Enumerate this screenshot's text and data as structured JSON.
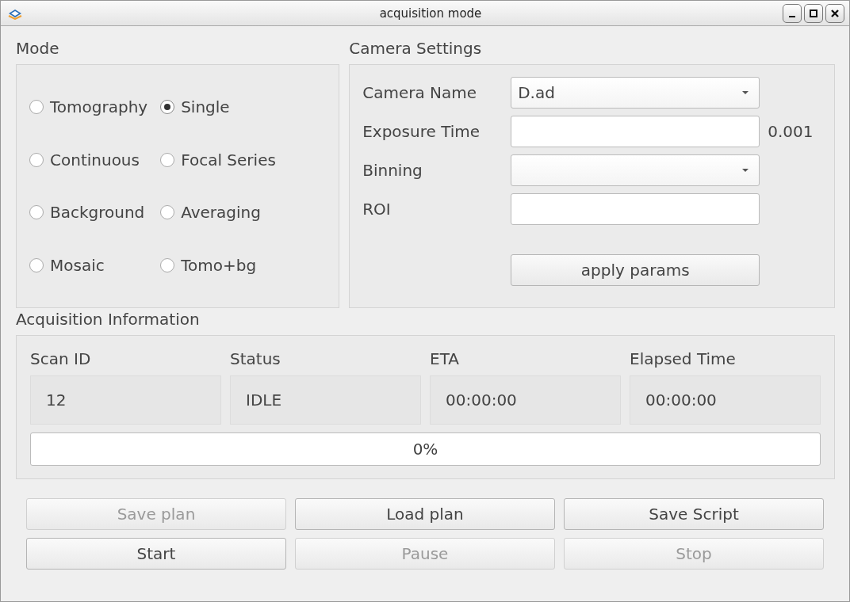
{
  "window": {
    "title": "acquisition mode"
  },
  "mode": {
    "title": "Mode",
    "options": [
      {
        "label": "Tomography",
        "selected": false
      },
      {
        "label": "Single",
        "selected": true
      },
      {
        "label": "Continuous",
        "selected": false
      },
      {
        "label": "Focal Series",
        "selected": false
      },
      {
        "label": "Background",
        "selected": false
      },
      {
        "label": "Averaging",
        "selected": false
      },
      {
        "label": "Mosaic",
        "selected": false
      },
      {
        "label": "Tomo+bg",
        "selected": false
      }
    ]
  },
  "camera": {
    "title": "Camera Settings",
    "fields": [
      {
        "kind": "dropdown",
        "label": "Camera Name",
        "value": "D.ad"
      },
      {
        "kind": "text",
        "label": "Exposure Time",
        "suffix": "0.001"
      },
      {
        "kind": "dropdown",
        "label": "Binning"
      },
      {
        "kind": "text",
        "label": "ROI"
      }
    ],
    "apply_button": "apply params"
  },
  "acquisition": {
    "title": "Acquisition Information",
    "columns": [
      {
        "label": "Scan ID",
        "value": "12"
      },
      {
        "label": "Status",
        "value": "IDLE"
      },
      {
        "label": "ETA",
        "value": "00:00:00"
      },
      {
        "label": "Elapsed Time",
        "value": "00:00:00"
      }
    ],
    "progress": {
      "level": 0,
      "text": "0%"
    }
  },
  "buttons": [
    {
      "label": "Save plan",
      "disabled": true
    },
    {
      "label": "Load plan",
      "disabled": false
    },
    {
      "label": "Save Script",
      "disabled": false
    },
    {
      "label": "Start",
      "disabled": false
    },
    {
      "label": "Pause",
      "disabled": true
    },
    {
      "label": "Stop",
      "disabled": true
    }
  ]
}
